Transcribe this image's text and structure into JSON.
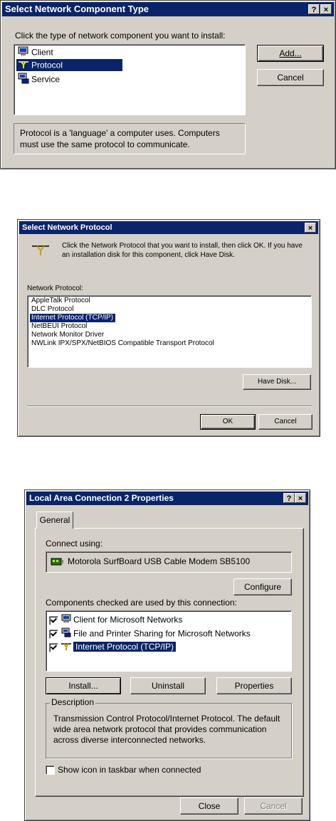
{
  "dialog1": {
    "title": "Select Network Component Type",
    "help_btn": "?",
    "close_btn": "×",
    "prompt": "Click the type of network component you want to install:",
    "items": [
      {
        "label": "Client",
        "icon": "client-computer-icon",
        "selected": false
      },
      {
        "label": "Protocol",
        "icon": "protocol-plug-icon",
        "selected": true
      },
      {
        "label": "Service",
        "icon": "service-computer-icon",
        "selected": false
      }
    ],
    "add_button": "Add...",
    "cancel_button": "Cancel",
    "description_line1": "Protocol is a 'language' a computer uses. Computers",
    "description_line2": "must use the same protocol to communicate."
  },
  "dialog2": {
    "title": "Select Network Protocol",
    "close_btn": "×",
    "instruction_line1": "Click the Network Protocol that you want to install, then click OK. If you have",
    "instruction_line2": "an installation disk for this component, click Have Disk.",
    "list_label": "Network Protocol:",
    "protocols": [
      {
        "label": "AppleTalk Protocol",
        "selected": false
      },
      {
        "label": "DLC Protocol",
        "selected": false
      },
      {
        "label": "Internet Protocol (TCP/IP)",
        "selected": true
      },
      {
        "label": "NetBEUI Protocol",
        "selected": false
      },
      {
        "label": "Network Monitor Driver",
        "selected": false
      },
      {
        "label": "NWLink IPX/SPX/NetBIOS Compatible Transport Protocol",
        "selected": false
      }
    ],
    "have_disk_button": "Have Disk...",
    "ok_button": "OK",
    "cancel_button": "Cancel"
  },
  "dialog3": {
    "title": "Local Area Connection 2 Properties",
    "help_btn": "?",
    "close_btn": "×",
    "tab_general": "General",
    "connect_using_label": "Connect using:",
    "adapter_name": "Motorola SurfBoard USB Cable Modem SB5100",
    "configure_button": "Configure",
    "components_label": "Components checked are used by this connection:",
    "components": [
      {
        "label": "Client for Microsoft Networks",
        "checked": true,
        "selected": false,
        "icon": "client-computer-icon"
      },
      {
        "label": "File and Printer Sharing for Microsoft Networks",
        "checked": true,
        "selected": false,
        "icon": "file-printer-sharing-icon"
      },
      {
        "label": "Internet Protocol (TCP/IP)",
        "checked": true,
        "selected": true,
        "icon": "protocol-plug-icon"
      }
    ],
    "install_button": "Install...",
    "uninstall_button": "Uninstall",
    "properties_button": "Properties",
    "description_group": "Description",
    "description_line1": "Transmission Control Protocol/Internet Protocol. The default",
    "description_line2": "wide area network protocol that provides communication",
    "description_line3": "across diverse interconnected networks.",
    "show_icon_label": "Show icon in taskbar when connected",
    "show_icon_checked": false,
    "close_button": "Close",
    "cancel_button": "Cancel"
  },
  "colors": {
    "face": "#d4d0c8",
    "titlebar": "#0a246a",
    "selection": "#0a246a"
  }
}
